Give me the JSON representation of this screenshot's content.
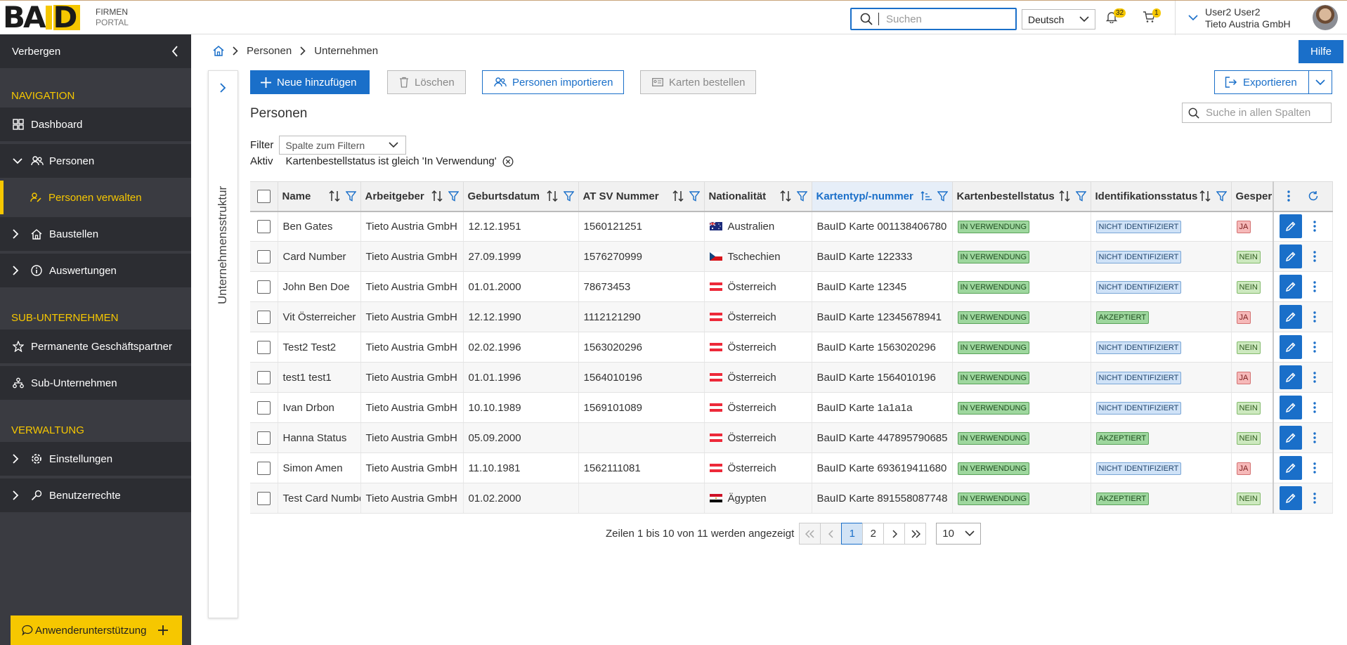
{
  "header": {
    "logo_text": "BAUID",
    "portal_line1": "FIRMEN",
    "portal_line2": "PORTAL",
    "search_placeholder": "Suchen",
    "language": "Deutsch",
    "notifications_count": "32",
    "cart_count": "1",
    "user_name": "User2 User2",
    "user_company": "Tieto Austria GmbH"
  },
  "sidebar": {
    "hide_label": "Verbergen",
    "sections": [
      {
        "title": "NAVIGATION"
      },
      {
        "title": "SUB-UNTERNEHMEN"
      },
      {
        "title": "VERWALTUNG"
      }
    ],
    "items": {
      "dashboard": "Dashboard",
      "personen": "Personen",
      "personen_verwalten": "Personen verwalten",
      "baustellen": "Baustellen",
      "auswertungen": "Auswertungen",
      "geschaeftspartner": "Permanente Geschäftspartner",
      "sub_unternehmen": "Sub-Unternehmen",
      "einstellungen": "Einstellungen",
      "benutzerrechte": "Benutzerrechte"
    },
    "support_label": "Anwenderunterstützung"
  },
  "structure_panel_label": "Unternehmensstruktur",
  "breadcrumb": [
    "Personen",
    "Unternehmen"
  ],
  "help_label": "Hilfe",
  "toolbar": {
    "add": "Neue hinzufügen",
    "delete": "Löschen",
    "import": "Personen importieren",
    "order_cards": "Karten bestellen",
    "export": "Exportieren"
  },
  "page_title": "Personen",
  "all_search_placeholder": "Suche in allen Spalten",
  "filter": {
    "label": "Filter",
    "select_placeholder": "Spalte zum Filtern",
    "active_label": "Aktiv",
    "active_value": "Kartenbestellstatus ist gleich 'In Verwendung'"
  },
  "table": {
    "columns": [
      "Name",
      "Arbeitgeber",
      "Geburtsdatum",
      "AT SV Nummer",
      "Nationalität",
      "Kartentyp/-nummer",
      "Kartenbestellstatus",
      "Identifikationsstatus",
      "Gesperrt"
    ],
    "rows": [
      {
        "name": "Ben Gates",
        "employer": "Tieto Austria GmbH",
        "dob": "12.12.1951",
        "sv": "1560121251",
        "flag": "au",
        "nat": "Australien",
        "card": "BauID Karte 001138406780",
        "order": "IN VERWENDUNG",
        "ident": "NICHT IDENTIFIZIERT",
        "ident_type": "b",
        "blocked": "JA"
      },
      {
        "name": "Card Number",
        "employer": "Tieto Austria GmbH",
        "dob": "27.09.1999",
        "sv": "1576270999",
        "flag": "cz",
        "nat": "Tschechien",
        "card": "BauID Karte 122333",
        "order": "IN VERWENDUNG",
        "ident": "NICHT IDENTIFIZIERT",
        "ident_type": "b",
        "blocked": "NEIN"
      },
      {
        "name": "John Ben Doe",
        "employer": "Tieto Austria GmbH",
        "dob": "01.01.2000",
        "sv": "78673453",
        "flag": "at",
        "nat": "Österreich",
        "card": "BauID Karte 12345",
        "order": "IN VERWENDUNG",
        "ident": "NICHT IDENTIFIZIERT",
        "ident_type": "b",
        "blocked": "NEIN"
      },
      {
        "name": "Vit Österreicher",
        "employer": "Tieto Austria GmbH",
        "dob": "12.12.1990",
        "sv": "1112121290",
        "flag": "at",
        "nat": "Österreich",
        "card": "BauID Karte 12345678941",
        "order": "IN VERWENDUNG",
        "ident": "AKZEPTIERT",
        "ident_type": "g",
        "blocked": "JA"
      },
      {
        "name": "Test2 Test2",
        "employer": "Tieto Austria GmbH",
        "dob": "02.02.1996",
        "sv": "1563020296",
        "flag": "at",
        "nat": "Österreich",
        "card": "BauID Karte 1563020296",
        "order": "IN VERWENDUNG",
        "ident": "NICHT IDENTIFIZIERT",
        "ident_type": "b",
        "blocked": "NEIN"
      },
      {
        "name": "test1 test1",
        "employer": "Tieto Austria GmbH",
        "dob": "01.01.1996",
        "sv": "1564010196",
        "flag": "at",
        "nat": "Österreich",
        "card": "BauID Karte 1564010196",
        "order": "IN VERWENDUNG",
        "ident": "NICHT IDENTIFIZIERT",
        "ident_type": "b",
        "blocked": "JA"
      },
      {
        "name": "Ivan Drbon",
        "employer": "Tieto Austria GmbH",
        "dob": "10.10.1989",
        "sv": "1569101089",
        "flag": "at",
        "nat": "Österreich",
        "card": "BauID Karte 1a1a1a",
        "order": "IN VERWENDUNG",
        "ident": "NICHT IDENTIFIZIERT",
        "ident_type": "b",
        "blocked": "NEIN"
      },
      {
        "name": "Hanna Status",
        "employer": "Tieto Austria GmbH",
        "dob": "05.09.2000",
        "sv": "",
        "flag": "at",
        "nat": "Österreich",
        "card": "BauID Karte 447895790685",
        "order": "IN VERWENDUNG",
        "ident": "AKZEPTIERT",
        "ident_type": "g",
        "blocked": "NEIN"
      },
      {
        "name": "Simon Amen",
        "employer": "Tieto Austria GmbH",
        "dob": "11.10.1981",
        "sv": "1562111081",
        "flag": "at",
        "nat": "Österreich",
        "card": "BauID Karte 693619411680",
        "order": "IN VERWENDUNG",
        "ident": "NICHT IDENTIFIZIERT",
        "ident_type": "b",
        "blocked": "JA"
      },
      {
        "name": "Test Card Number",
        "employer": "Tieto Austria GmbH",
        "dob": "01.02.2000",
        "sv": "",
        "flag": "eg",
        "nat": "Ägypten",
        "card": "BauID Karte 891558087748",
        "order": "IN VERWENDUNG",
        "ident": "AKZEPTIERT",
        "ident_type": "g",
        "blocked": "NEIN"
      }
    ]
  },
  "pager": {
    "summary": "Zeilen 1 bis 10 von 11 werden angezeigt",
    "pages": [
      "1",
      "2"
    ],
    "current": "1",
    "page_size": "10"
  },
  "colors": {
    "accent": "#1a6fc9",
    "brand_yellow": "#f6c700",
    "sidebar_bg": "#3a3b41"
  }
}
